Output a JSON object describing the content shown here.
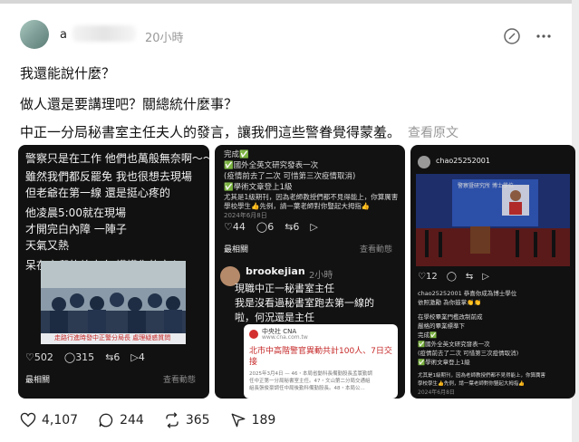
{
  "header": {
    "username_visible": "a",
    "time": "20小時"
  },
  "post": {
    "line1": "我還能說什麼？",
    "line2": "做人還是要講理吧？關總統什麼事？",
    "line3": "中正一分局秘書室主任夫人的發言，讓我們這些警眷覺得蒙羞。",
    "translate": "查看原文"
  },
  "panel1": {
    "lines": [
      "警察只是在工作 他們也萬般無奈啊～～",
      "雖然我們都反罷免 我也很想去現場",
      "但老爺在第一線 還是挺心疼的",
      "他凌晨5:00就在現場",
      "才開完白內障 一陣子",
      "天氣又熱",
      "呆在官邸的賴皮鬼 摸摸你的良心"
    ],
    "photo_caption": "走路行進時發中正警分局長 處理疑惑質問",
    "stats": {
      "likes": "502",
      "comments": "315",
      "reposts": "6",
      "shares": "4"
    },
    "related": "最相關",
    "view_activity": "查看動態"
  },
  "panel2": {
    "top_lines": [
      "完成✅",
      "✅國外全英文研究發表一次",
      "(疫情前去了二次 可惜第三次疫情取消)",
      "✅學術文章登上1級",
      "尤其是1級期刊，因為老師教授們都不見得能上，你算厲害",
      "學校學生👍先例，請一葉老師對你豎起大拇指👍",
      "2024年6月8日"
    ],
    "stats": {
      "likes": "44",
      "comments": "6",
      "reposts": "6"
    },
    "related": "最相關",
    "view_activity": "查看動態",
    "reply_user": "brookejian",
    "reply_time": "2小時",
    "reply_lines": [
      "現職中正一秘書室主任",
      "我是沒看過秘書室跑去第一線的",
      "啦，何況還是主任"
    ],
    "news_source": "中央社 CNA",
    "news_domain": "www.cna.com.tw",
    "news_title_1": "北市中高階警官異動共計100人、7日交",
    "news_title_2": "接",
    "news_body_1": "2025年3月4日 — 46・本局省動科長備勤股長孟寰勤調",
    "news_body_2": "任中正第一分局秘書室主任。47・文山第二分局交通組",
    "news_body_3": "組長張俊豪調任中局後勤科備勤股長。48・本局公..."
  },
  "panel3": {
    "username": "chao25252001",
    "stage_text": "警察暨研究所 博士學位",
    "stats": {
      "likes": "12",
      "comments": "",
      "reposts": "",
      "shares": ""
    },
    "reply_lines": [
      "chao25252001 恭喜你成為博士學位",
      "依照激勵 為你鼓掌👏👏",
      "",
      "在學校畢業門檻改制前成",
      "嚴格的畢業標準下",
      "完成✅",
      "✅國外全英文研究發表一次",
      "(疫情前去了二次 可惜第三次疫情取消)",
      "✅學術文章登上1級",
      "",
      "尤其是1級期刊，因為老師教授們都不見得能上，你算厲害",
      "學校學生👍先例，請一葉老師對你豎起大拇指👍",
      "2024年6月8日"
    ]
  },
  "footer": {
    "likes": "4,107",
    "comments": "244",
    "reposts": "365",
    "shares": "189"
  },
  "colors": {
    "accent_red": "#e0245e",
    "link_red": "#c62828",
    "dark_panel": "#111111"
  }
}
